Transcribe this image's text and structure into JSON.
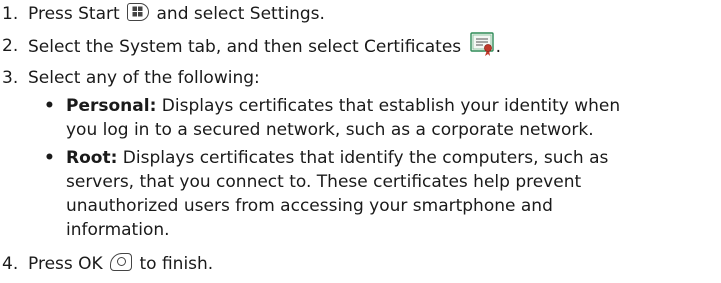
{
  "steps": [
    {
      "num": "1.",
      "before": "Press Start",
      "after": "and select Settings.",
      "icon": "start-key-icon"
    },
    {
      "num": "2.",
      "before": "Select the System tab, and then select Certificates",
      "after": ".",
      "icon": "certificate-icon"
    },
    {
      "num": "3.",
      "text": "Select any of the following:"
    },
    {
      "num": "4.",
      "before": "Press OK",
      "after": "to finish.",
      "icon": "ok-key-icon"
    }
  ],
  "bullets": [
    {
      "term": "Personal:",
      "lines": [
        "Displays certificates that establish your identity when",
        "you log in to a secured network, such as a corporate network."
      ]
    },
    {
      "term": "Root:",
      "lines": [
        "Displays certificates that identify the computers, such as",
        "servers, that you connect to. These certificates help prevent",
        "unauthorized users from accessing your smartphone and",
        "information."
      ]
    }
  ],
  "bullet_glyph": "•",
  "colors": {
    "text": "#1a1a1a",
    "icon_stroke": "#444444",
    "cert_green": "#2e8b57",
    "cert_red": "#c0392b"
  }
}
